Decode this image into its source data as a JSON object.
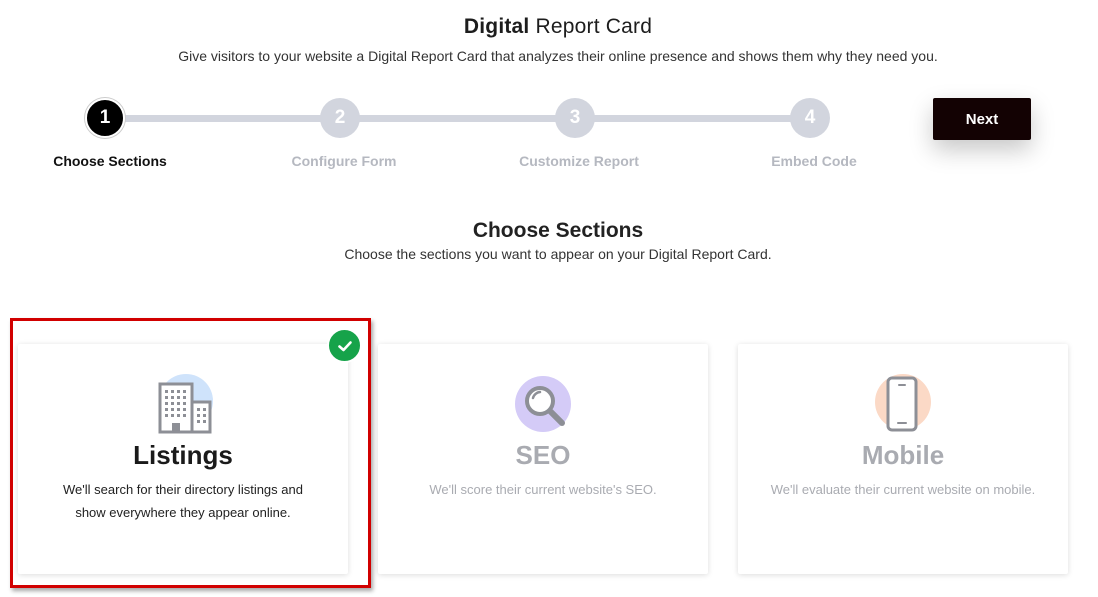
{
  "header": {
    "title_bold": "Digital",
    "title_rest": "Report Card",
    "subtitle": "Give visitors to your website a Digital Report Card that analyzes their online presence and shows them why they need you."
  },
  "stepper": {
    "steps": [
      {
        "number": "1",
        "label": "Choose Sections",
        "active": true
      },
      {
        "number": "2",
        "label": "Configure Form",
        "active": false
      },
      {
        "number": "3",
        "label": "Customize Report",
        "active": false
      },
      {
        "number": "4",
        "label": "Embed Code",
        "active": false
      }
    ],
    "next_label": "Next"
  },
  "section": {
    "title": "Choose Sections",
    "subtitle": "Choose the sections you want to appear on your Digital Report Card."
  },
  "cards": [
    {
      "icon": "building-icon",
      "title": "Listings",
      "description": "We'll search for their directory listings and show everywhere they appear online.",
      "selected": true
    },
    {
      "icon": "magnifier-icon",
      "title": "SEO",
      "description": "We'll score their current website's SEO.",
      "selected": false
    },
    {
      "icon": "phone-icon",
      "title": "Mobile",
      "description": "We'll evaluate their current website on mobile.",
      "selected": false
    }
  ],
  "colors": {
    "accent_dark": "#130203",
    "step_inactive": "#d2d5de",
    "check_green": "#16a34a",
    "highlight_red": "#d10000"
  }
}
